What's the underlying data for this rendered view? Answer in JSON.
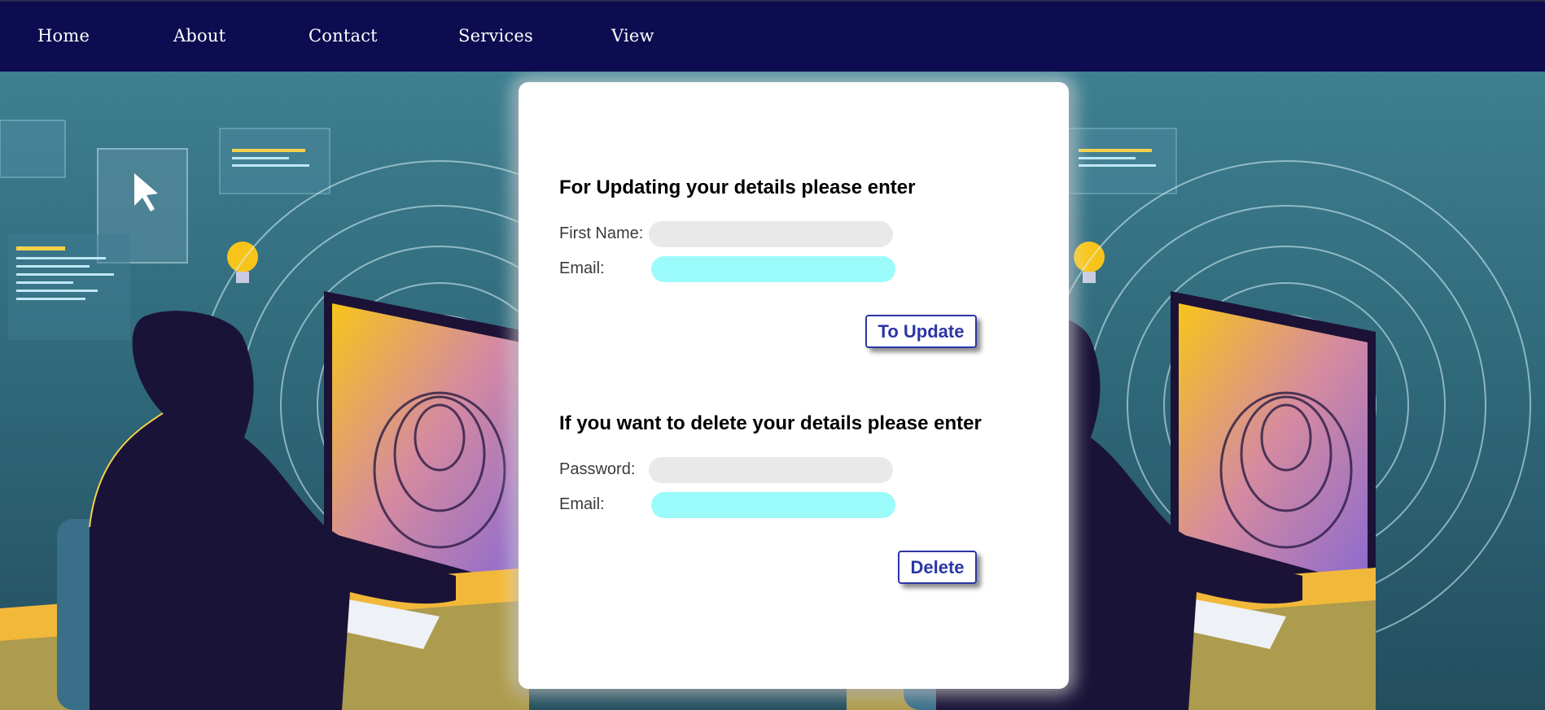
{
  "nav": {
    "items": [
      {
        "label": "Home"
      },
      {
        "label": "About"
      },
      {
        "label": "Contact"
      },
      {
        "label": "Services"
      },
      {
        "label": "View"
      }
    ]
  },
  "update_section": {
    "heading": "For Updating your details please enter",
    "first_name_label": "First Name:",
    "first_name_value": "",
    "email_label": "Email:",
    "email_value": "",
    "button_label": "To Update"
  },
  "delete_section": {
    "heading": "If you want to delete your details please enter",
    "password_label": "Password:",
    "password_value": "",
    "email_label": "Email:",
    "email_value": "",
    "button_label": "Delete"
  },
  "colors": {
    "navbar": "#0e0c50",
    "button_text": "#2b36a6",
    "input_grey": "#e9e9e9",
    "input_cyan": "#9bfbfb"
  }
}
